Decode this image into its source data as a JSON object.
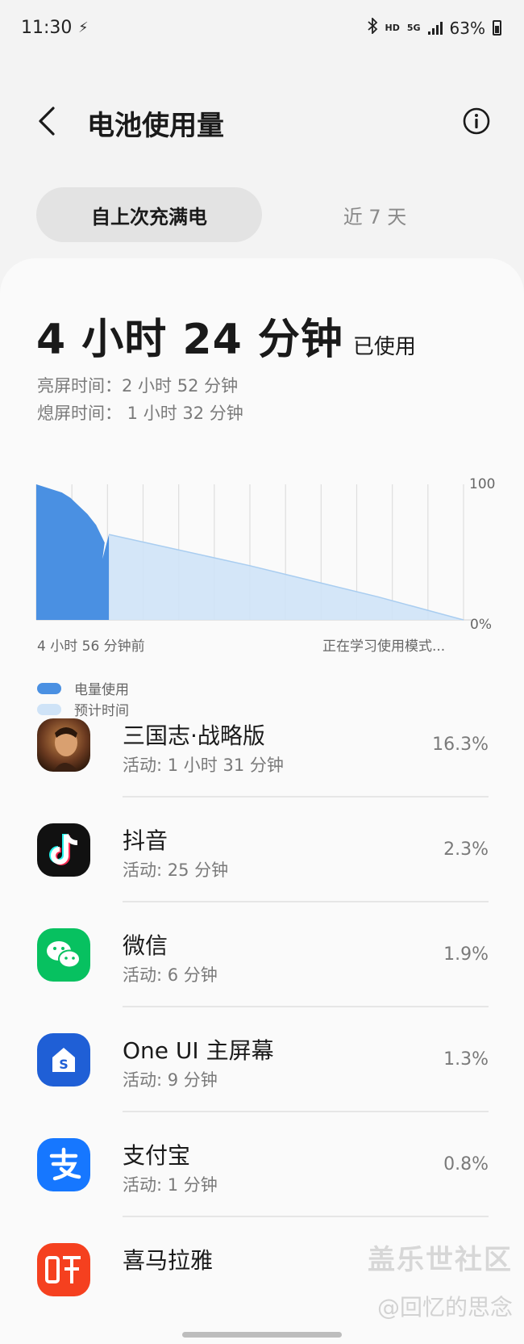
{
  "status": {
    "time": "11:30",
    "hd": "HD",
    "net": "5G",
    "battery": "63%"
  },
  "header": {
    "title": "电池使用量"
  },
  "tabs": [
    {
      "label": "自上次充满电"
    },
    {
      "label": "近 7 天"
    }
  ],
  "summary": {
    "total": "4 小时 24 分钟",
    "used_suffix": "已使用",
    "screen_on": "亮屏时间：2 小时 52 分钟",
    "screen_off": "熄屏时间： 1 小时 32 分钟"
  },
  "chart": {
    "y_top_label": "100",
    "y_bottom_label": "0%",
    "x_left_label": "4 小时 56 分钟前",
    "x_right_label": "正在学习使用模式..."
  },
  "chart_data": {
    "type": "area",
    "ylim": [
      0,
      100
    ],
    "x_unit": "fraction of chart time span (0 = 4 小时 56 分钟前)",
    "series": [
      {
        "name": "电量使用",
        "points": [
          [
            0,
            100
          ],
          [
            0.02,
            98
          ],
          [
            0.04,
            96
          ],
          [
            0.06,
            94
          ],
          [
            0.08,
            90
          ],
          [
            0.1,
            84
          ],
          [
            0.12,
            78
          ],
          [
            0.14,
            70
          ],
          [
            0.16,
            57
          ],
          [
            0.155,
            45
          ],
          [
            0.17,
            63
          ]
        ]
      },
      {
        "name": "预计时间",
        "points": [
          [
            0.17,
            63
          ],
          [
            0.5,
            40
          ],
          [
            0.8,
            17
          ],
          [
            1.0,
            0
          ]
        ]
      }
    ],
    "legend_placement": "bottom-left"
  },
  "legend": [
    {
      "label": "电量使用",
      "color": "#4a90e2"
    },
    {
      "label": "预计时间",
      "color": "#cfe3f7"
    }
  ],
  "apps": [
    {
      "name": "三国志·战略版",
      "activity": "活动: 1 小时 31 分钟",
      "percent": "16.3%",
      "icon": "game-portrait-icon"
    },
    {
      "name": "抖音",
      "activity": "活动: 25 分钟",
      "percent": "2.3%",
      "icon": "tiktok-icon"
    },
    {
      "name": "微信",
      "activity": "活动: 6 分钟",
      "percent": "1.9%",
      "icon": "wechat-icon"
    },
    {
      "name": "One UI 主屏幕",
      "activity": "活动: 9 分钟",
      "percent": "1.3%",
      "icon": "oneui-home-icon"
    },
    {
      "name": "支付宝",
      "activity": "活动: 1 分钟",
      "percent": "0.8%",
      "icon": "alipay-icon"
    },
    {
      "name": "喜马拉雅",
      "activity": "",
      "percent": "",
      "icon": "ximalaya-icon"
    }
  ],
  "watermark": {
    "line1": "盖乐世社区",
    "line2": "@回忆的思念"
  }
}
